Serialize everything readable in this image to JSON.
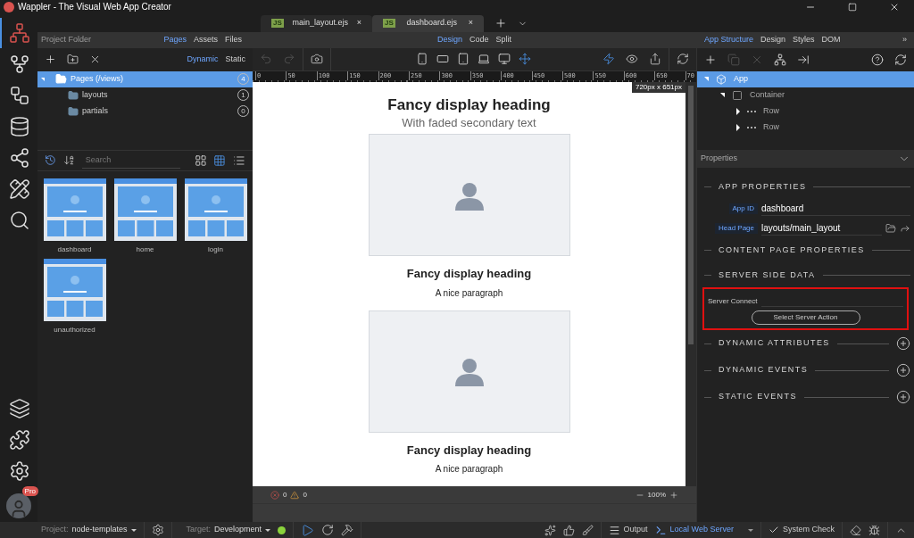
{
  "window": {
    "title": "Wappler - The Visual Web App Creator"
  },
  "rail": {
    "top": [
      {
        "kind": "structure",
        "selected": true
      },
      {
        "kind": "fork",
        "selected": false
      },
      {
        "kind": "flow",
        "selected": false
      },
      {
        "kind": "database",
        "selected": false
      },
      {
        "kind": "share",
        "selected": false
      },
      {
        "kind": "design",
        "selected": false
      },
      {
        "kind": "search",
        "selected": false
      }
    ],
    "bottom": [
      {
        "kind": "layers",
        "selected": false
      },
      {
        "kind": "puzzle",
        "selected": false
      },
      {
        "kind": "settings",
        "selected": false
      }
    ],
    "user": {
      "badge": "Pro"
    }
  },
  "file_tabs": [
    {
      "badge": "JS",
      "label": "main_layout.ejs",
      "close": "×",
      "selected": false
    },
    {
      "badge": "JS",
      "label": "dashboard.ejs",
      "close": "×",
      "selected": true
    }
  ],
  "project_panel": {
    "title": "Project Folder",
    "tabs": [
      {
        "label": "Pages",
        "selected": true
      },
      {
        "label": "Assets",
        "selected": false
      },
      {
        "label": "Files",
        "selected": false
      }
    ],
    "modes": [
      {
        "label": "Dynamic",
        "selected": true
      },
      {
        "label": "Static",
        "selected": false
      }
    ],
    "tree": [
      {
        "label": "Pages (/views)",
        "count": "4",
        "selected": true,
        "expanded": true,
        "children": [
          {
            "label": "layouts",
            "count": "1",
            "selected": false
          },
          {
            "label": "partials",
            "count": "0",
            "selected": false
          }
        ]
      }
    ],
    "search": {
      "placeholder": "Search"
    },
    "view_modes": [
      {
        "kind": "large",
        "selected": false
      },
      {
        "kind": "small",
        "selected": true
      },
      {
        "kind": "list",
        "selected": false
      }
    ],
    "pages": [
      {
        "name": "dashboard"
      },
      {
        "name": "home"
      },
      {
        "name": "login"
      },
      {
        "name": "unauthorized"
      }
    ]
  },
  "editor": {
    "modes": [
      {
        "label": "Design",
        "selected": true
      },
      {
        "label": "Code",
        "selected": false
      },
      {
        "label": "Split",
        "selected": false
      }
    ],
    "devices": [
      {
        "kind": "phone",
        "selected": false
      },
      {
        "kind": "tablet-landscape",
        "selected": false
      },
      {
        "kind": "tablet",
        "selected": false
      },
      {
        "kind": "laptop",
        "selected": false
      },
      {
        "kind": "desktop",
        "selected": false
      },
      {
        "kind": "responsive",
        "selected": true
      }
    ],
    "ruler": [
      "0",
      "50",
      "100",
      "150",
      "200",
      "250",
      "300",
      "350",
      "400",
      "450",
      "500",
      "550",
      "600",
      "650",
      "70"
    ],
    "size_label": "720px x 651px",
    "canvas": {
      "title": "Fancy display heading",
      "subtitle": "With faded secondary text",
      "cards": [
        {
          "heading": "Fancy display heading",
          "text": "A nice paragraph"
        },
        {
          "heading": "Fancy display heading",
          "text": "A nice paragraph"
        }
      ]
    },
    "errors": "0",
    "warnings": "0",
    "zoom": "100%"
  },
  "structure_panel": {
    "tabs": [
      {
        "label": "App Structure",
        "selected": true
      },
      {
        "label": "Design",
        "selected": false
      },
      {
        "label": "Styles",
        "selected": false
      },
      {
        "label": "DOM",
        "selected": false
      }
    ],
    "more": "»",
    "tree": [
      {
        "label": "App",
        "kind": "app",
        "selected": true,
        "expanded": true,
        "children": [
          {
            "label": "Container",
            "kind": "container",
            "selected": false,
            "expanded": true,
            "children": [
              {
                "label": "Row",
                "kind": "row",
                "selected": false,
                "expanded": false
              },
              {
                "label": "Row",
                "kind": "row",
                "selected": false,
                "expanded": false
              }
            ]
          }
        ]
      }
    ],
    "properties": {
      "title": "Properties",
      "sections": [
        {
          "title": "APP PROPERTIES",
          "fields": [
            {
              "label": "App ID",
              "value": "dashboard"
            },
            {
              "label": "Head Page",
              "value": "layouts/main_layout",
              "browse": true
            }
          ]
        },
        {
          "title": "CONTENT PAGE PROPERTIES"
        },
        {
          "title": "SERVER SIDE DATA",
          "highlighted": true,
          "server_connect": {
            "label": "Server Connect",
            "button": "Select Server Action"
          }
        },
        {
          "title": "DYNAMIC ATTRIBUTES",
          "addable": true
        },
        {
          "title": "DYNAMIC EVENTS",
          "addable": true
        },
        {
          "title": "STATIC EVENTS",
          "addable": true
        }
      ]
    }
  },
  "status_bar": {
    "project_label": "Project:",
    "project": "node-templates",
    "target_label": "Target:",
    "target": "Development",
    "server_running": true,
    "output": "Output",
    "server": "Local Web Server",
    "system_check": "System Check"
  }
}
